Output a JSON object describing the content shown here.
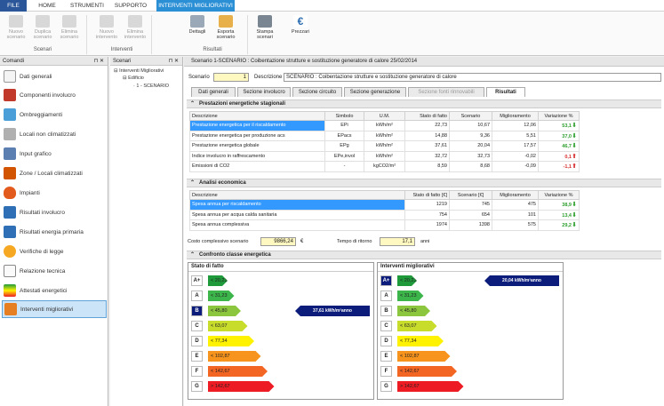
{
  "menu": {
    "tabs": [
      "FILE",
      "HOME",
      "STRUMENTI",
      "SUPPORTO",
      "INTERVENTI MIGLIORATIVI"
    ]
  },
  "ribbon": {
    "buttons": [
      {
        "label": "Nuovo scenario",
        "enabled": false
      },
      {
        "label": "Duplica scenario",
        "enabled": false
      },
      {
        "label": "Elimina scenario",
        "enabled": false
      },
      {
        "label": "Nuovo intervento",
        "enabled": false
      },
      {
        "label": "Elimina intervento",
        "enabled": false
      },
      {
        "label": "Dettagli",
        "enabled": true
      },
      {
        "label": "Esporta scenario",
        "enabled": true
      },
      {
        "label": "Stampa scenari",
        "enabled": true
      },
      {
        "label": "Prezzari",
        "enabled": true
      }
    ],
    "groups": [
      "Scenari",
      "Interventi",
      "Risultati"
    ]
  },
  "comandi": {
    "title": "Comandi",
    "items": [
      "Dati generali",
      "Componenti involucro",
      "Ombreggiamenti",
      "Locali non climatizzati",
      "Input grafico",
      "Zone / Locali climatizzati",
      "Impianti",
      "Risultati involucro",
      "Risultati energia primaria",
      "Verifiche di legge",
      "Relazione tecnica",
      "Attestati energetici",
      "Interventi migliorativi"
    ]
  },
  "scenari": {
    "title": "Scenari",
    "tree": [
      "Interventi Migliorativi",
      "Edificio",
      "1 - SCENARIO"
    ]
  },
  "main": {
    "title": "Scenario 1-SCENARIO : Coibentazione strutture e sostituzione generatore di calore 25/02/2014",
    "scenario_label": "Scenario",
    "scenario_value": "1",
    "descr_label": "Descrizione",
    "descr_value": "SCENARIO : Coibentazione strutture e sostituzione generatore di calore",
    "tabs": [
      "Dati generali",
      "Sezione involucro",
      "Sezione circuito",
      "Sezione generazione",
      "Sezione fonti rinnovabili",
      "Risultati"
    ],
    "section1": "Prestazioni energetiche stagionali",
    "t1_headers": [
      "Descrizione",
      "Simbolo",
      "U.M.",
      "Stato di fatto",
      "Scenario",
      "Miglioramento",
      "Variazione %"
    ],
    "t1_rows": [
      [
        "Prestazione energetica per il riscaldamento",
        "EPi",
        "kWh/m²",
        "22,73",
        "10,67",
        "12,06",
        "53,1",
        "up"
      ],
      [
        "Prestazione energetica per produzione acs",
        "EPacs",
        "kWh/m²",
        "14,88",
        "9,36",
        "5,51",
        "37,0",
        "up"
      ],
      [
        "Prestazione energetica globale",
        "EPg",
        "kWh/m²",
        "37,61",
        "20,04",
        "17,57",
        "46,7",
        "up"
      ],
      [
        "Indice involucro in raffrescamento",
        "EPe,invol",
        "kWh/m²",
        "32,72",
        "32,73",
        "-0,02",
        "0,1",
        "down"
      ],
      [
        "Emissioni di CO2",
        "-",
        "kgCO2/m²",
        "8,59",
        "8,68",
        "-0,09",
        "-1,1",
        "down"
      ]
    ],
    "section2": "Analisi economica",
    "t2_headers": [
      "Descrizione",
      "Stato di fatto [€]",
      "Scenario [€]",
      "Miglioramento",
      "Variazione %"
    ],
    "t2_rows": [
      [
        "Spesa annua per riscaldamento",
        "1219",
        "745",
        "475",
        "38,9",
        "up"
      ],
      [
        "Spesa annua per acqua calda sanitaria",
        "754",
        "654",
        "101",
        "13,4",
        "up"
      ],
      [
        "Spesa annua complessiva",
        "1974",
        "1398",
        "575",
        "29,2",
        "up"
      ]
    ],
    "cost_label": "Costo complessivo scenario",
    "cost_value": "9866,24",
    "cost_unit": "€",
    "ritorno_label": "Tempo di ritorno",
    "ritorno_value": "17,1",
    "ritorno_unit": "anni",
    "section3": "Confronto classe energetica",
    "box1_title": "Stato di fatto",
    "box2_title": "Interventi migliorativi",
    "classes": [
      {
        "cls": "A+",
        "label": "< 20,23",
        "color": "#1f9a3a"
      },
      {
        "cls": "A",
        "label": "< 31,23",
        "color": "#3cb54a"
      },
      {
        "cls": "B",
        "label": "< 45,80",
        "color": "#8cc63f"
      },
      {
        "cls": "C",
        "label": "< 63,07",
        "color": "#c8dc2c"
      },
      {
        "cls": "D",
        "label": "< 77,34",
        "color": "#fff200"
      },
      {
        "cls": "E",
        "label": "< 102,87",
        "color": "#f7941d"
      },
      {
        "cls": "F",
        "label": "< 142,67",
        "color": "#f26522"
      },
      {
        "cls": "G",
        "label": "> 142,67",
        "color": "#ed1c24"
      }
    ],
    "box1_pointer": "37,61 kWh/m²anno",
    "box1_pointer_class": "B",
    "box2_pointer": "20,04 kWh/m²anno",
    "box2_pointer_class": "A+"
  }
}
